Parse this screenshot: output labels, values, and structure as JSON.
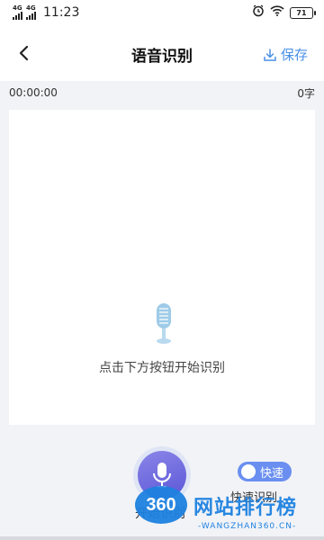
{
  "status_bar": {
    "network1": "4G",
    "network2": "4G",
    "time": "11:23",
    "battery": "71"
  },
  "header": {
    "title": "语音识别",
    "save_label": "保存"
  },
  "info": {
    "timer": "00:00:00",
    "word_count": "0字"
  },
  "panel": {
    "hint": "点击下方按钮开始识别"
  },
  "controls": {
    "record_label": "开始识别",
    "toggle_text": "快速",
    "quick_label": "快速识别"
  },
  "watermark": {
    "logo_text": "360",
    "title": "网站排行榜",
    "subtitle": "-WANGZHAN360.CN-"
  },
  "colors": {
    "accent": "#4a8fe7",
    "record_button": "#6b66de",
    "toggle": "#6a8ff0",
    "watermark": "#1e82e0"
  }
}
